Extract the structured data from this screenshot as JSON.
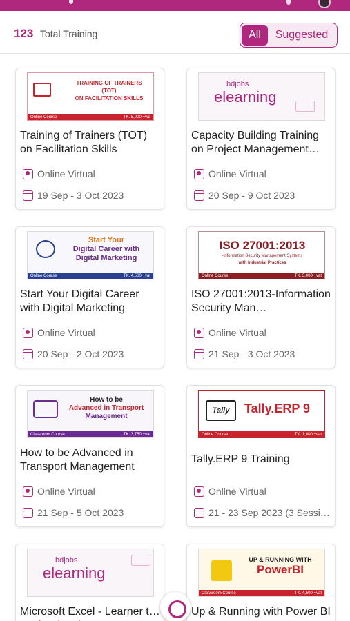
{
  "summary": {
    "count": "123",
    "label": "Total Training"
  },
  "filter": {
    "all": "All",
    "suggested": "Suggested"
  },
  "cards": [
    {
      "title": "Training of Trainers (TOT) on Facilitation Skills",
      "location": "Online Virtual",
      "dates": "19 Sep - 3 Oct 2023",
      "banner": {
        "line1": "TRAINING OF TRAINERS",
        "line2": "(TOT)",
        "line3": "ON FACILITATION SKILLS",
        "type": "Online Course",
        "price": "TK. 5,000 +vat"
      }
    },
    {
      "title": "Capacity Building Training on  Project Management…",
      "location": "Online Virtual",
      "dates": "20 Sep - 9 Oct 2023",
      "banner": {
        "brand": "bdjobs",
        "name": "elearning"
      }
    },
    {
      "title": "Start Your Digital Career with Digital Marketing",
      "location": "Online Virtual",
      "dates": "20 Sep - 2 Oct 2023",
      "banner": {
        "line1": "Start Your",
        "line2": "Digital Career with",
        "line3": "Digital Marketing",
        "type": "Online Course",
        "price": "TK. 4,500 +vat"
      }
    },
    {
      "title": "ISO 27001:2013-Information Security Man…",
      "location": "Online Virtual",
      "dates": "21 Sep - 3 Oct 2023",
      "banner": {
        "line1": "ISO 27001:2013",
        "line2": "-Information Security Management Systems",
        "line3": "with Industrial Practices",
        "type": "Online Course",
        "price": "TK. 3,000 +vat"
      }
    },
    {
      "title": "How to be Advanced in Transport Management",
      "location": "Online Virtual",
      "dates": "21 Sep - 5 Oct 2023",
      "banner": {
        "line1": "How to be",
        "line2": "Advanced in Transport",
        "line3": "Management",
        "type": "Classroom Course",
        "price": "TK. 3,750 +vat"
      }
    },
    {
      "title": "Tally.ERP 9 Training",
      "location": "Online Virtual",
      "dates": "21 - 23 Sep 2023 (3 Sessio…",
      "banner": {
        "logo": "Tally",
        "line1": "Tally.ERP 9",
        "type": "Online Course",
        "price": "TK. 1,800 +vat"
      }
    },
    {
      "title": "Microsoft Excel - Learner t… Professional",
      "location": "",
      "dates": "",
      "banner": {
        "brand": "bdjobs",
        "name": "elearning"
      }
    },
    {
      "title": "Up & Running with Power BI",
      "location": "",
      "dates": "",
      "banner": {
        "line1": "UP & RUNNING WITH",
        "line2": "PowerBI",
        "type": "Classroom Course",
        "price": "TK. 4,500 +vat"
      }
    }
  ],
  "colors": {
    "brand": "#b0277e",
    "red": "#c8222c",
    "purple": "#6a2c91"
  }
}
